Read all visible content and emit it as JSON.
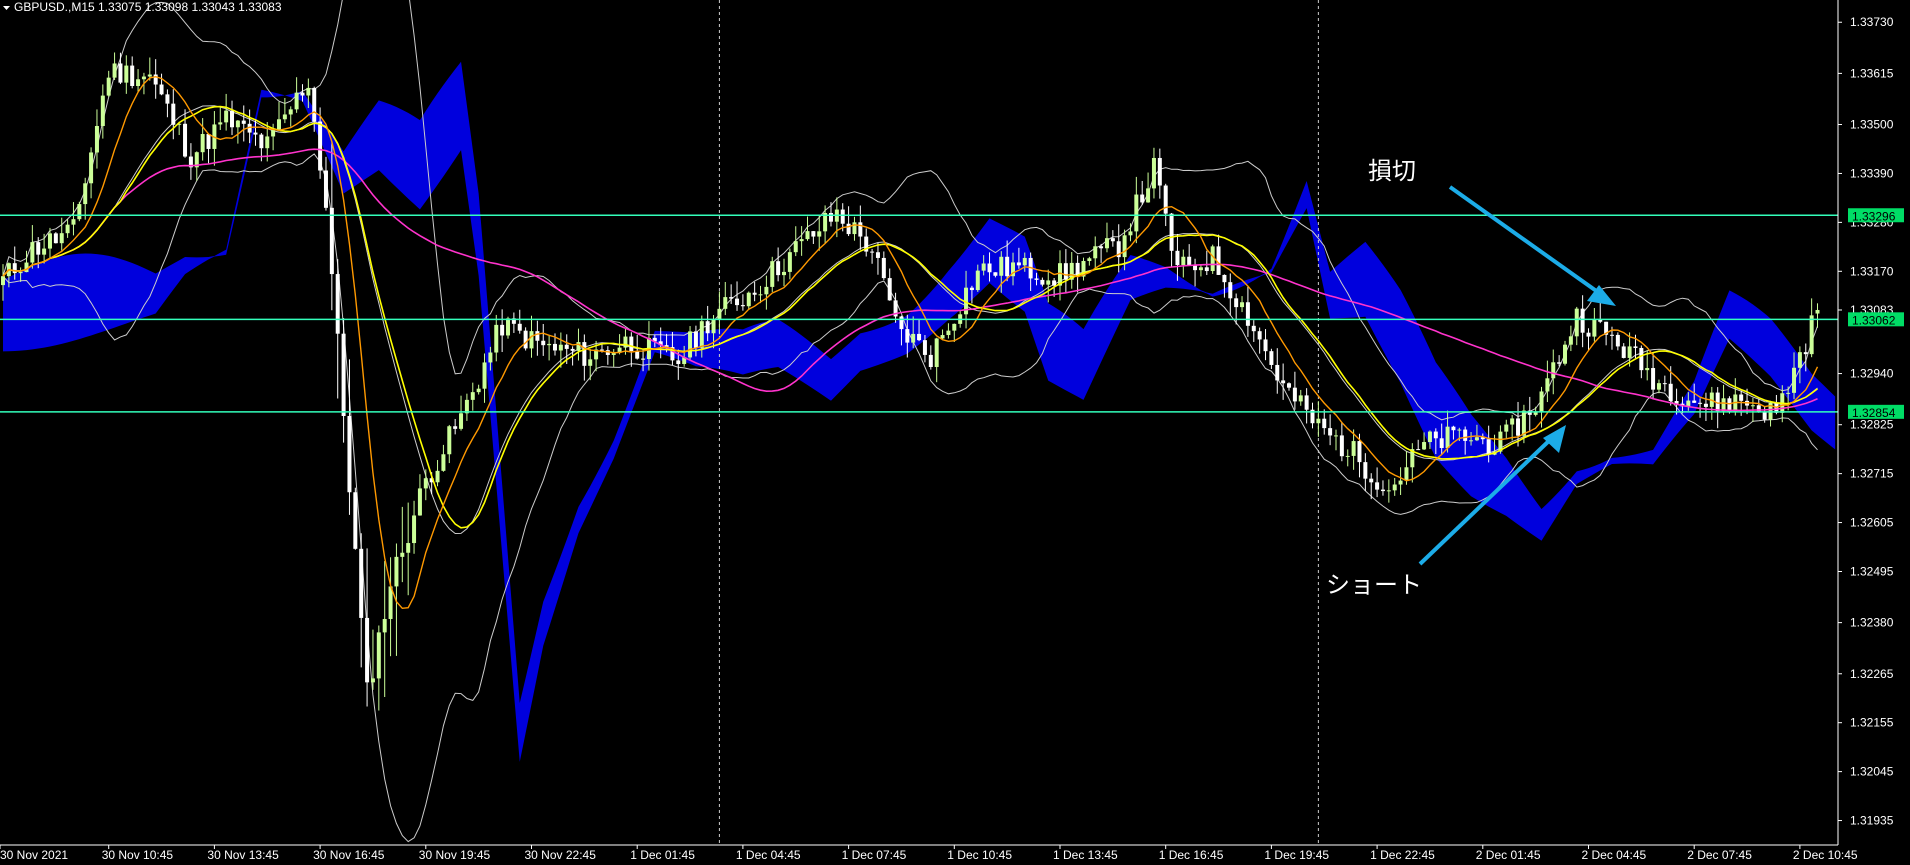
{
  "header": {
    "symbol_info": "GBPUSD.,M15  1.33075 1.33098 1.33043 1.33083"
  },
  "colors": {
    "background": "#000000",
    "bull": "#ccff99",
    "bear": "#ffffff",
    "cloud": "#0000dd",
    "level": "#33ffbb",
    "level_label_bg": "#00dd66",
    "ma_yellow": "#ffff00",
    "ma_orange": "#ff9900",
    "ma_magenta": "#ff33cc",
    "bands": "#cccccc",
    "arrow": "#1cace8",
    "period_sep": "#cccccc"
  },
  "price_axis": {
    "ticks": [
      "1.33730",
      "1.33615",
      "1.33500",
      "1.33390",
      "1.33280",
      "1.33170",
      "1.33083",
      "1.32940",
      "1.32825",
      "1.32715",
      "1.32605",
      "1.32495",
      "1.32380",
      "1.32265",
      "1.32155",
      "1.32045",
      "1.31935"
    ],
    "level_labels": [
      "1.33296",
      "1.33062",
      "1.32854"
    ]
  },
  "time_axis": {
    "labels": [
      "30 Nov 2021",
      "30 Nov 10:45",
      "30 Nov 13:45",
      "30 Nov 16:45",
      "30 Nov 19:45",
      "30 Nov 22:45",
      "1 Dec 01:45",
      "1 Dec 04:45",
      "1 Dec 07:45",
      "1 Dec 10:45",
      "1 Dec 13:45",
      "1 Dec 16:45",
      "1 Dec 19:45",
      "1 Dec 22:45",
      "2 Dec 01:45",
      "2 Dec 04:45",
      "2 Dec 07:45",
      "2 Dec 10:45"
    ]
  },
  "levels": [
    1.33296,
    1.33062,
    1.32854
  ],
  "annotations": {
    "stop_loss": "損切",
    "short": "ショート"
  },
  "indicators": {
    "ichimoku_cloud": true,
    "bollinger_bands": true,
    "moving_averages": [
      "yellow",
      "orange",
      "magenta"
    ]
  },
  "chart_data": {
    "type": "candlestick",
    "symbol": "GBPUSD.",
    "timeframe": "M15",
    "last_bar": {
      "open": 1.33075,
      "high": 1.33098,
      "low": 1.33043,
      "close": 1.33083
    },
    "price_range": [
      1.3188,
      1.3378
    ],
    "horizontal_levels": [
      1.33296,
      1.33062,
      1.32854
    ],
    "series": [
      {
        "name": "close",
        "points": [
          [
            0,
            1.3315
          ],
          [
            5,
            1.3322
          ],
          [
            12,
            1.3326
          ],
          [
            18,
            1.3362
          ],
          [
            25,
            1.3361
          ],
          [
            32,
            1.3343
          ],
          [
            38,
            1.3351
          ],
          [
            45,
            1.3345
          ],
          [
            52,
            1.336
          ],
          [
            55,
            1.3332
          ],
          [
            58,
            1.3285
          ],
          [
            62,
            1.3222
          ],
          [
            66,
            1.3247
          ],
          [
            72,
            1.327
          ],
          [
            78,
            1.3284
          ],
          [
            85,
            1.3305
          ],
          [
            92,
            1.33
          ],
          [
            100,
            1.3298
          ],
          [
            106,
            1.3301
          ],
          [
            115,
            1.3297
          ],
          [
            120,
            1.3306
          ],
          [
            128,
            1.3313
          ],
          [
            135,
            1.3322
          ],
          [
            142,
            1.333
          ],
          [
            148,
            1.3322
          ],
          [
            152,
            1.3305
          ],
          [
            158,
            1.3298
          ],
          [
            166,
            1.3317
          ],
          [
            172,
            1.3318
          ],
          [
            180,
            1.3316
          ],
          [
            190,
            1.3323
          ],
          [
            196,
            1.334
          ],
          [
            200,
            1.3317
          ],
          [
            206,
            1.332
          ],
          [
            212,
            1.3307
          ],
          [
            218,
            1.3291
          ],
          [
            224,
            1.3282
          ],
          [
            230,
            1.3276
          ],
          [
            236,
            1.3268
          ],
          [
            242,
            1.3278
          ],
          [
            248,
            1.328
          ],
          [
            255,
            1.3278
          ],
          [
            262,
            1.3289
          ],
          [
            268,
            1.3307
          ],
          [
            275,
            1.3301
          ],
          [
            282,
            1.3292
          ],
          [
            290,
            1.3287
          ],
          [
            296,
            1.3288
          ],
          [
            302,
            1.3285
          ],
          [
            306,
            1.3298
          ],
          [
            309,
            1.3308
          ]
        ]
      }
    ]
  }
}
